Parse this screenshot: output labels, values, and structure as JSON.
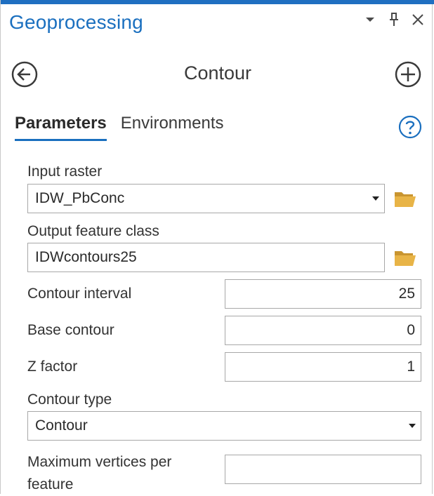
{
  "window": {
    "title": "Geoprocessing",
    "icons": [
      "dropdown-arrow-icon",
      "pin-icon",
      "close-icon"
    ]
  },
  "tool": {
    "name": "Contour",
    "back_icon": "arrow-left-circle-icon",
    "add_icon": "plus-circle-icon"
  },
  "tabs": [
    {
      "label": "Parameters",
      "active": true
    },
    {
      "label": "Environments",
      "active": false
    }
  ],
  "help_icon": "question-circle-icon",
  "params": {
    "input_raster": {
      "label": "Input raster",
      "value": "IDW_PbConc"
    },
    "output_feature_class": {
      "label": "Output feature class",
      "value": "IDWcontours25"
    },
    "contour_interval": {
      "label": "Contour interval",
      "value": "25"
    },
    "base_contour": {
      "label": "Base contour",
      "value": "0"
    },
    "z_factor": {
      "label": "Z factor",
      "value": "1"
    },
    "contour_type": {
      "label": "Contour type",
      "value": "Contour"
    },
    "max_vertices": {
      "label": "Maximum vertices per feature",
      "value": ""
    }
  },
  "colors": {
    "accent": "#1a6fbf",
    "folder": "#e8b447"
  }
}
